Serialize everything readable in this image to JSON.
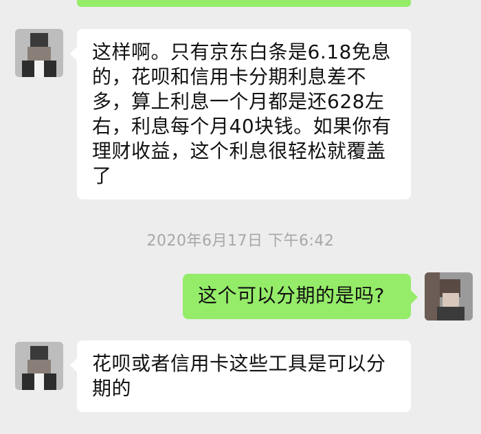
{
  "messages": [
    {
      "side": "left",
      "text": "这样啊。只有京东白条是6.18免息的，花呗和信用卡分期利息差不多，算上利息一个月都是还628左右，利息每个月40块钱。如果你有理财收益，这个利息很轻松就覆盖了"
    },
    {
      "side": "right",
      "text": "这个可以分期的是吗?"
    },
    {
      "side": "left",
      "text": "花呗或者信用卡这些工具是可以分期的"
    }
  ],
  "timestamp": "2020年6月17日 下午6:42",
  "colors": {
    "background": "#ededed",
    "incoming_bubble": "#ffffff",
    "outgoing_bubble": "#95ec69",
    "timestamp_text": "#a7a7a7"
  }
}
